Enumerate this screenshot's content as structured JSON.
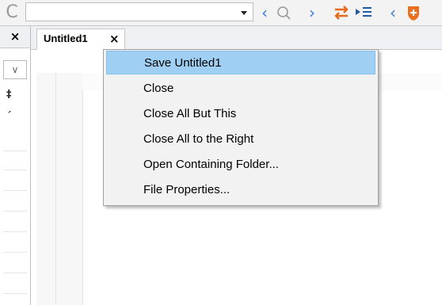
{
  "toolbar": {
    "refresh_glyph": "C",
    "dropdown_glyph": "▾",
    "icons": [
      {
        "name": "prev-arrow-icon",
        "glyph": "‹",
        "color": "#3a7bd5"
      },
      {
        "name": "search-icon",
        "glyph": "🔍",
        "color": "#8a8a8a"
      },
      {
        "name": "next-arrow-icon",
        "glyph": "›",
        "color": "#3a7bd5"
      },
      {
        "name": "swap-arrows-icon",
        "glyph": "⇆",
        "color": "#e56a1c"
      },
      {
        "name": "indent-list-icon",
        "glyph": "▸☰",
        "color": "#1e5aa8"
      },
      {
        "name": "collapse-left-icon",
        "glyph": "‹",
        "color": "#3a7bd5"
      },
      {
        "name": "plugin-shield-icon",
        "glyph": "⛊",
        "color": "#e8701f"
      }
    ]
  },
  "side_panel": {
    "close_glyph": "×",
    "dropdown_glyph": "∨",
    "glyphs": [
      "‡",
      "ˊ"
    ]
  },
  "tab": {
    "title": "Untitled1",
    "close_glyph": "×"
  },
  "context_menu": {
    "items": [
      {
        "label": "Save Untitled1",
        "selected": true
      },
      {
        "label": "Close",
        "selected": false
      },
      {
        "label": "Close All But This",
        "selected": false
      },
      {
        "label": "Close All to the Right",
        "selected": false
      },
      {
        "label": "Open Containing Folder...",
        "selected": false
      },
      {
        "label": "File Properties...",
        "selected": false
      }
    ]
  },
  "colors": {
    "highlight": "#9fd0f3",
    "menu_bg": "#f2f2f2"
  }
}
